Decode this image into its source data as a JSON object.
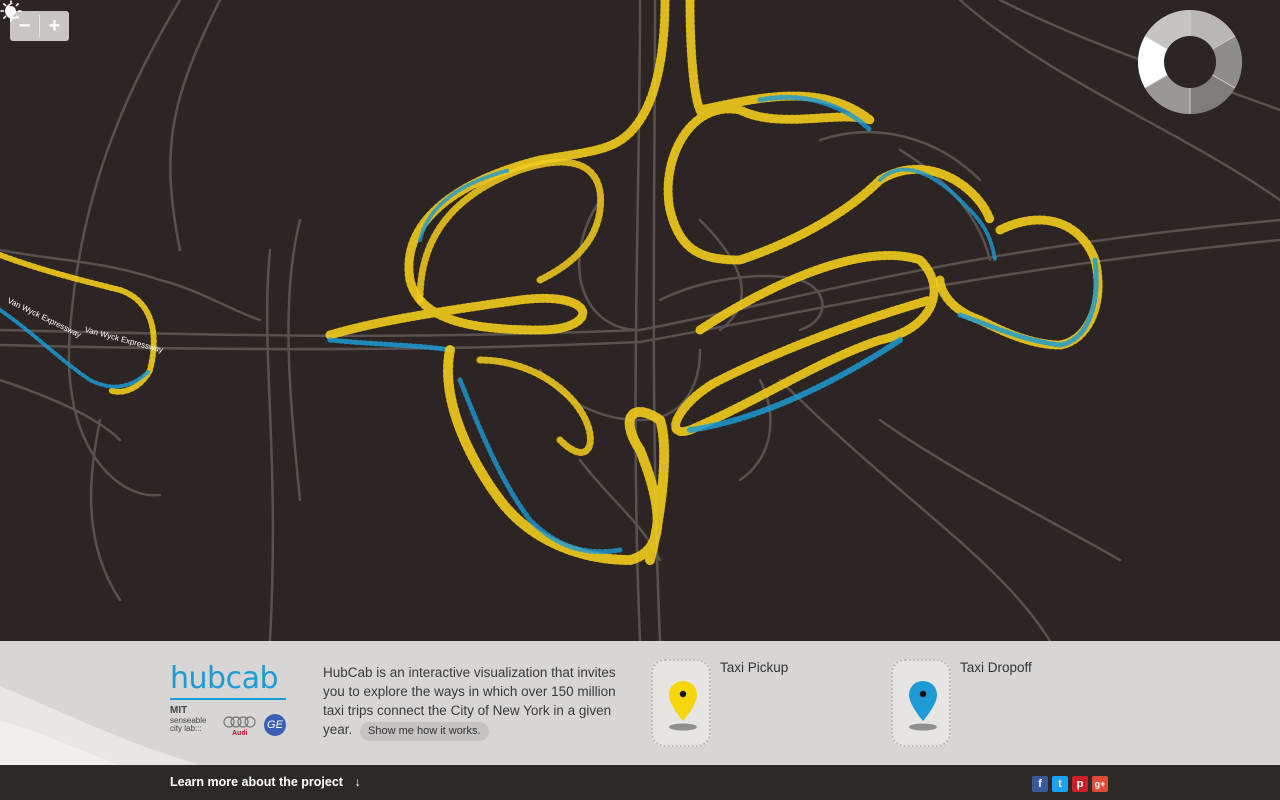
{
  "map": {
    "zoom_out_label": "−",
    "zoom_in_label": "+",
    "road_labels": [
      "Van Wyck Expressway",
      "Van Wyck Expressway"
    ],
    "colors": {
      "background": "#2d2523",
      "roads": "#5a5350",
      "pickup": "#f2cc1d",
      "dropoff": "#1c9bd4"
    }
  },
  "time_control": {
    "sun_icon": "sun-icon",
    "moon_icon": "moon-icon"
  },
  "footer": {
    "logo": "hubcab",
    "partners": {
      "mit": "MIT",
      "senseable_line1": "senseable",
      "senseable_line2": "city lab:::",
      "audi": "Audi",
      "ge": "GE"
    },
    "description": "HubCab is an interactive visualization that invites you to explore the ways in which over 150 million taxi trips connect the City of New York in a given year.",
    "how_button": "Show me how it works.",
    "pickup_label": "Taxi Pickup",
    "dropoff_label": "Taxi Dropoff",
    "pickup_color": "#f5d60a",
    "dropoff_color": "#1c9bd4"
  },
  "bottom_bar": {
    "learn_more": "Learn more about the project",
    "social": [
      {
        "icon": "facebook-icon",
        "glyph": "f",
        "color": "#3b5998"
      },
      {
        "icon": "twitter-icon",
        "glyph": "t",
        "color": "#1da1f2"
      },
      {
        "icon": "pinterest-icon",
        "glyph": "p",
        "color": "#cb2027"
      },
      {
        "icon": "googleplus-icon",
        "glyph": "g+",
        "color": "#dd4b39"
      }
    ]
  }
}
